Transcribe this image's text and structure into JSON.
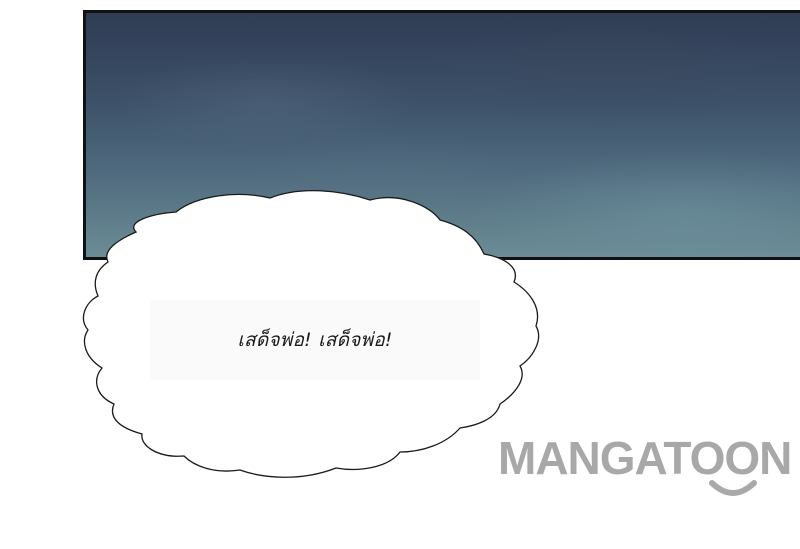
{
  "speech_bubble": {
    "text": "เสด็จพ่อ! เสด็จพ่อ!"
  },
  "watermark": {
    "brand": "MANGATOON",
    "color": "#9a9a9a"
  },
  "sky_panel": {
    "colors": {
      "top": "#2f3c54",
      "bottom": "#6b8c95",
      "border": "#111111"
    }
  }
}
